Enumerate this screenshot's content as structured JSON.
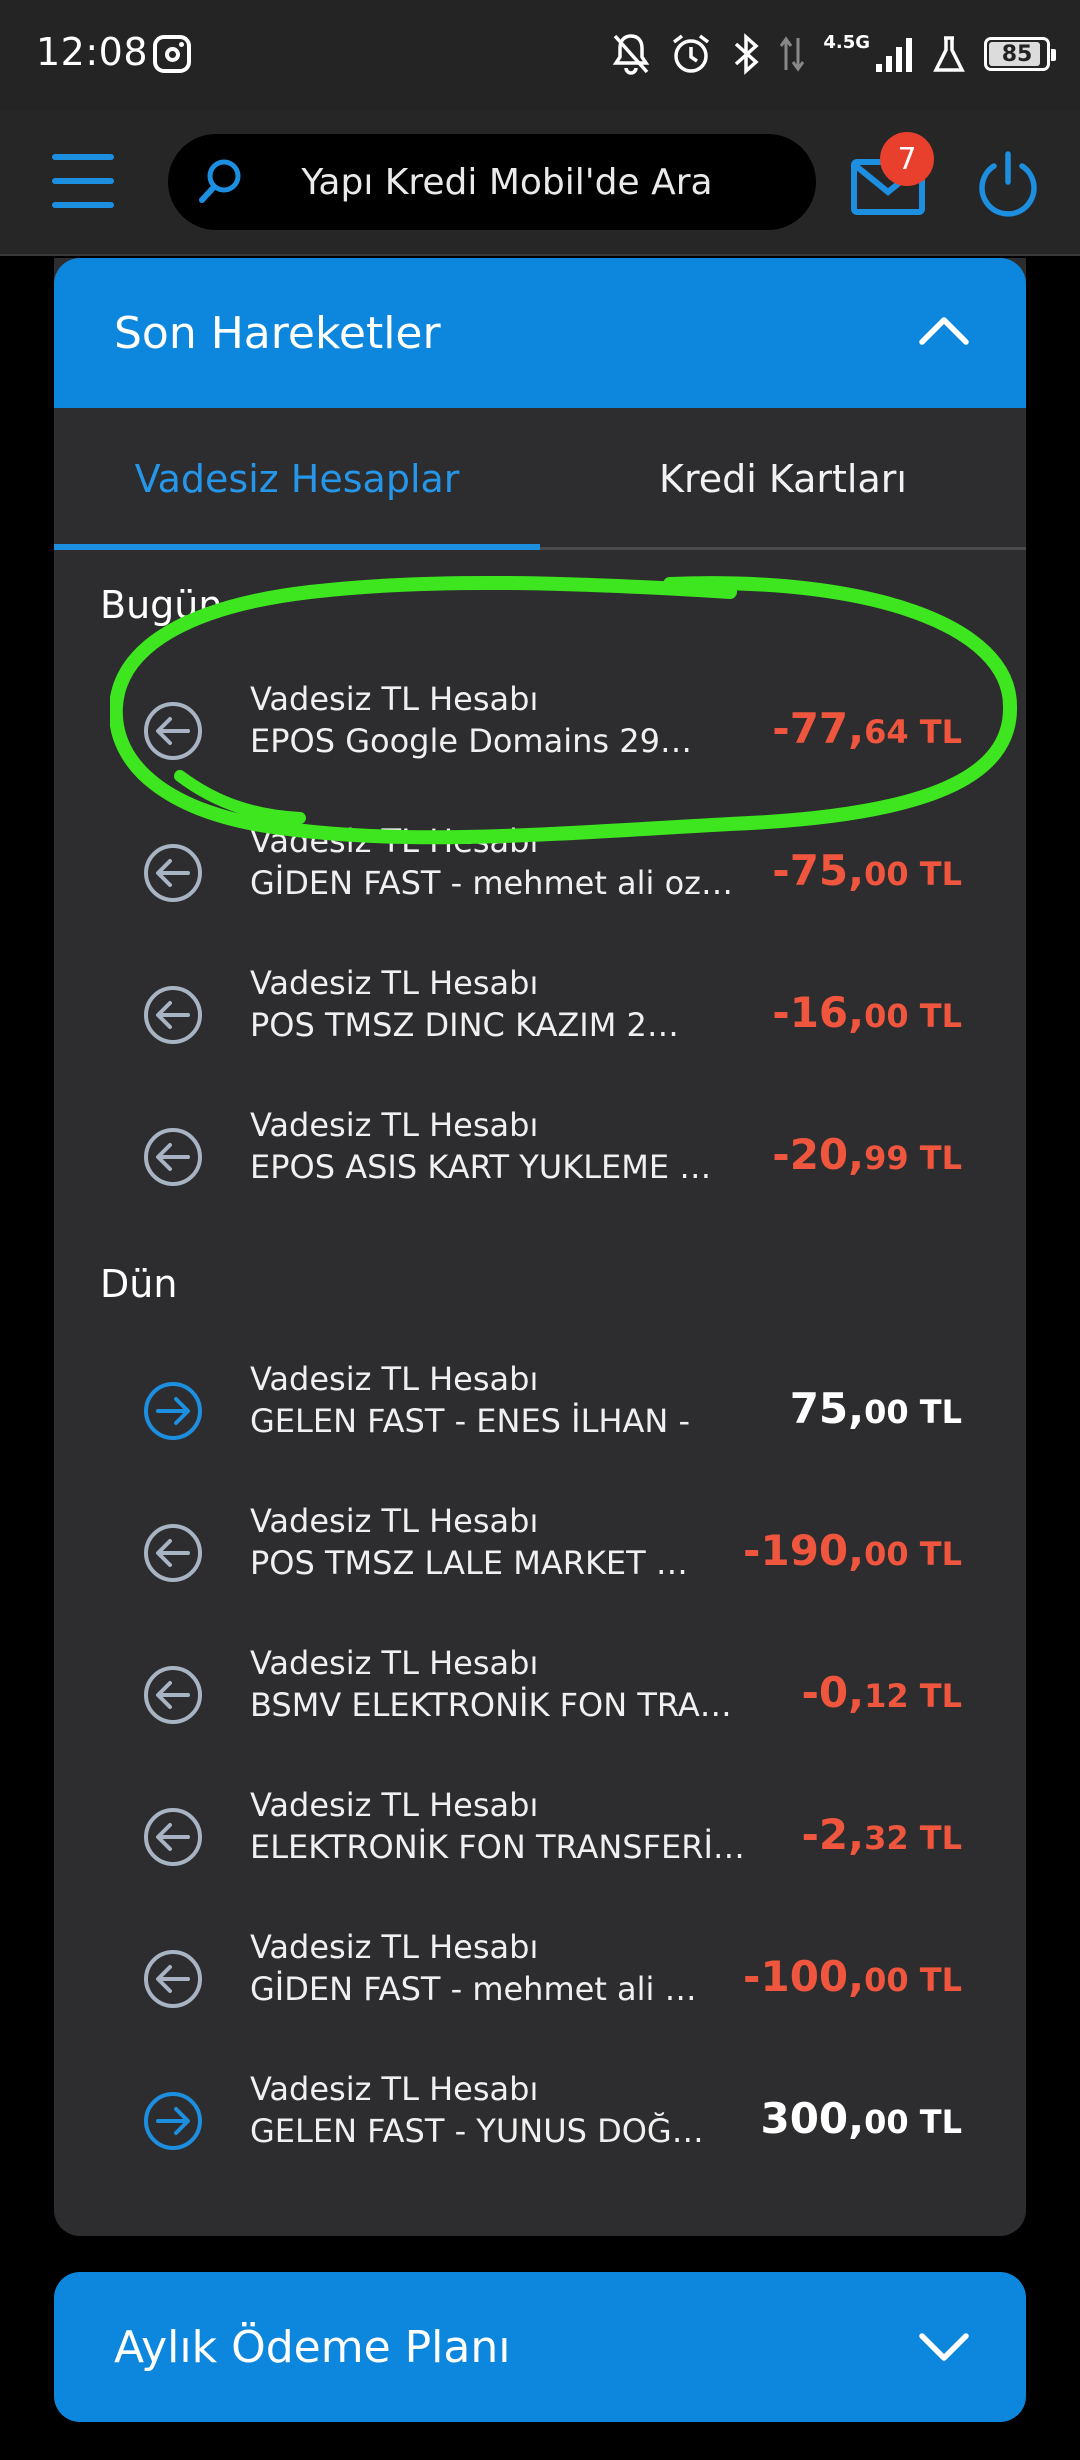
{
  "status_bar": {
    "time": "12:08",
    "network": "4.5G",
    "battery": "85"
  },
  "header": {
    "search_placeholder": "Yapı Kredi Mobil'de Ara",
    "mail_badge": "7"
  },
  "recent": {
    "title": "Son Hareketler",
    "tabs": [
      {
        "label": "Vadesiz Hesaplar",
        "active": true
      },
      {
        "label": "Kredi Kartları",
        "active": false
      }
    ],
    "sections": [
      {
        "label": "Bugün",
        "items": [
          {
            "account": "Vadesiz TL Hesabı",
            "description": "EPOS Google Domains      29…",
            "amount_main": "-77,",
            "amount_dec": "64 TL",
            "direction": "out"
          },
          {
            "account": "Vadesiz TL Hesabı",
            "description": "GİDEN FAST - mehmet ali oz…",
            "amount_main": "-75,",
            "amount_dec": "00 TL",
            "direction": "out"
          },
          {
            "account": "Vadesiz TL Hesabı",
            "description": "POS TMSZ DINC KAZIM      2…",
            "amount_main": "-16,",
            "amount_dec": "00 TL",
            "direction": "out"
          },
          {
            "account": "Vadesiz TL Hesabı",
            "description": "EPOS ASIS KART YUKLEME   …",
            "amount_main": "-20,",
            "amount_dec": "99 TL",
            "direction": "out"
          }
        ]
      },
      {
        "label": "Dün",
        "items": [
          {
            "account": "Vadesiz TL Hesabı",
            "description": "GELEN FAST - ENES İLHAN -",
            "amount_main": "75,",
            "amount_dec": "00 TL",
            "direction": "in"
          },
          {
            "account": "Vadesiz TL Hesabı",
            "description": "POS TMSZ LALE MARKET    …",
            "amount_main": "-190,",
            "amount_dec": "00 TL",
            "direction": "out"
          },
          {
            "account": "Vadesiz TL Hesabı",
            "description": "BSMV ELEKTRONİK FON TRA…",
            "amount_main": "-0,",
            "amount_dec": "12 TL",
            "direction": "out"
          },
          {
            "account": "Vadesiz TL Hesabı",
            "description": "ELEKTRONİK FON TRANSFERİ…",
            "amount_main": "-2,",
            "amount_dec": "32 TL",
            "direction": "out"
          },
          {
            "account": "Vadesiz TL Hesabı",
            "description": "GİDEN FAST - mehmet ali …",
            "amount_main": "-100,",
            "amount_dec": "00 TL",
            "direction": "out"
          },
          {
            "account": "Vadesiz TL Hesabı",
            "description": "GELEN FAST - YUNUS DOĞ…",
            "amount_main": "300,",
            "amount_dec": "00 TL",
            "direction": "in"
          }
        ]
      }
    ]
  },
  "monthly_plan": {
    "title": "Aylık Ödeme Planı"
  },
  "colors": {
    "accent": "#0d87dd",
    "negative": "#f0563e",
    "highlight": "#3de61f"
  }
}
